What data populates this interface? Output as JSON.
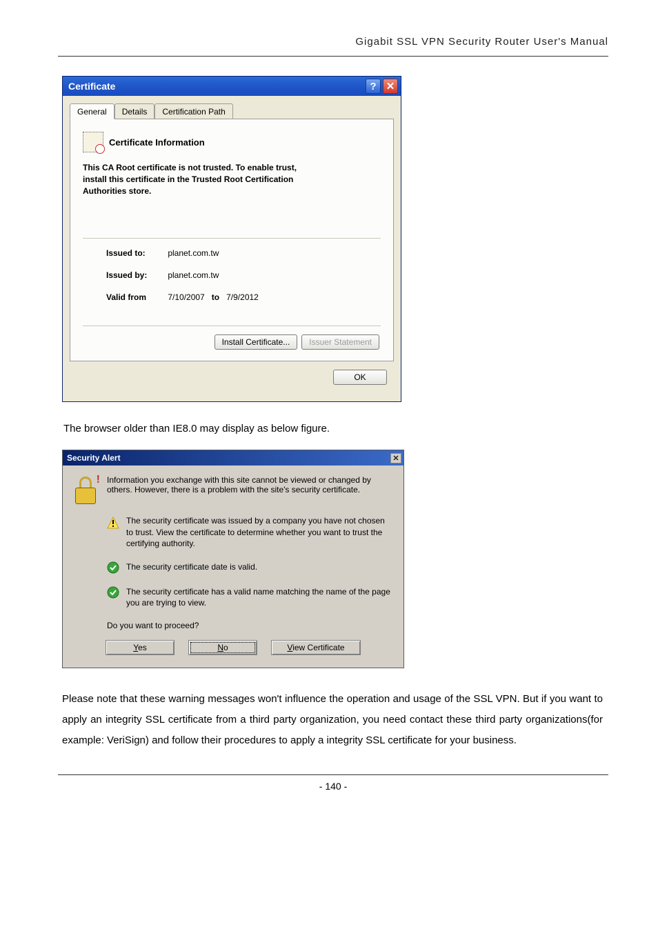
{
  "header": {
    "title": "Gigabit SSL VPN Security Router User's Manual"
  },
  "cert_dialog": {
    "title": "Certificate",
    "help_glyph": "?",
    "close_glyph": "✕",
    "tabs": {
      "general": "General",
      "details": "Details",
      "path": "Certification Path"
    },
    "info_title": "Certificate Information",
    "warn_line1": "This CA Root certificate is not trusted. To enable trust,",
    "warn_line2": "install this certificate in the Trusted Root Certification",
    "warn_line3": "Authorities store.",
    "issued_to_label": "Issued to:",
    "issued_to_value": "planet.com.tw",
    "issued_by_label": "Issued by:",
    "issued_by_value": "planet.com.tw",
    "valid_label_from": "Valid from",
    "valid_from": "7/10/2007",
    "valid_label_to": "to",
    "valid_to": "7/9/2012",
    "install_btn": "Install Certificate...",
    "issuer_btn": "Issuer Statement",
    "ok_btn": "OK"
  },
  "mid_text": "The browser older than IE8.0 may display as below figure.",
  "sa_dialog": {
    "title": "Security Alert",
    "close_glyph": "✕",
    "intro": "Information you exchange with this site cannot be viewed or changed by others. However, there is a problem with the site's security certificate.",
    "item1": "The security certificate was issued by a company you have not chosen to trust. View the certificate to determine whether you want to trust the certifying authority.",
    "item2": "The security certificate date is valid.",
    "item3": "The security certificate has a valid name matching the name of the page you are trying to view.",
    "proceed": "Do you want to proceed?",
    "yes_u": "Y",
    "yes_rest": "es",
    "no_u": "N",
    "no_rest": "o",
    "view_u": "V",
    "view_rest": "iew Certificate"
  },
  "paragraph": "Please note that these warning messages won't influence the operation and usage of the SSL VPN. But if you want to apply an integrity SSL certificate from a third party organization, you need contact these third party organizations(for example: VeriSign) and follow their procedures to apply a integrity SSL certificate for your business.",
  "page_number": "- 140 -"
}
